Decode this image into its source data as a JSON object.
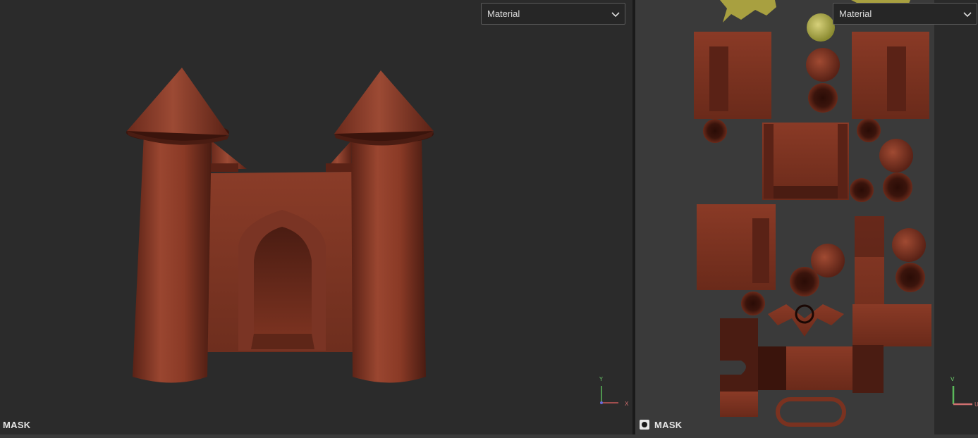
{
  "left_viewport": {
    "material_dropdown": "Material",
    "mode_label": "MASK",
    "axes": {
      "y": "Y",
      "x": "X"
    }
  },
  "right_viewport": {
    "material_dropdown": "Material",
    "mode_label": "MASK",
    "axes": {
      "v": "V",
      "u": "U"
    }
  },
  "colors": {
    "background": "#2b2b2b",
    "rust": "#8a3a26",
    "rust_dark": "#4a1c12",
    "uv_yellow": "#b8b04a"
  },
  "icons": [
    "chevron-down-icon",
    "mask-icon",
    "axis-gizmo-icon"
  ]
}
